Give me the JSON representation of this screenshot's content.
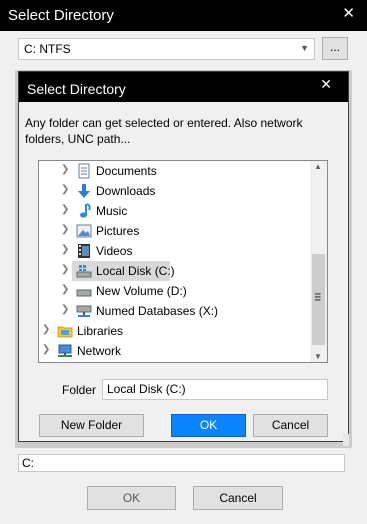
{
  "outer": {
    "title": "Select Directory",
    "close_glyph": "✕",
    "drive_value": "C:   NTFS",
    "drive_arrow": "▼",
    "browse_label": "...",
    "path_value": "C:",
    "ok_label": "OK",
    "cancel_label": "Cancel"
  },
  "dialog": {
    "title": "Select Directory",
    "close_glyph": "✕",
    "description": "Any folder can get selected or entered. Also network folders, UNC path...",
    "tree": [
      {
        "label": "Documents",
        "icon": "documents-icon",
        "level": 1
      },
      {
        "label": "Downloads",
        "icon": "downloads-icon",
        "level": 1
      },
      {
        "label": "Music",
        "icon": "music-icon",
        "level": 1
      },
      {
        "label": "Pictures",
        "icon": "pictures-icon",
        "level": 1
      },
      {
        "label": "Videos",
        "icon": "videos-icon",
        "level": 1
      },
      {
        "label": "Local Disk (C:)",
        "icon": "local-disk-icon",
        "level": 1,
        "selected": true
      },
      {
        "label": "New Volume (D:)",
        "icon": "drive-icon",
        "level": 1
      },
      {
        "label": "Numed Databases (X:)",
        "icon": "network-drive-icon",
        "level": 1
      },
      {
        "label": "Libraries",
        "icon": "libraries-icon",
        "level": 0
      },
      {
        "label": "Network",
        "icon": "network-icon",
        "level": 0
      }
    ],
    "folder_label": "Folder",
    "folder_value": "Local Disk (C:)",
    "new_folder_label": "New Folder",
    "ok_label": "OK",
    "cancel_label": "Cancel"
  },
  "colors": {
    "title_bar": "#000000",
    "ok_accent": "#0a84ff",
    "selection": "#d9d9d9"
  }
}
